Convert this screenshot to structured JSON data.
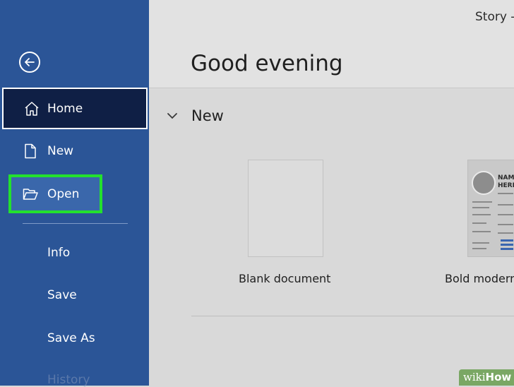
{
  "window": {
    "doc_title": "Story -"
  },
  "sidebar": {
    "items": [
      {
        "label": "Home",
        "icon": "home-icon"
      },
      {
        "label": "New",
        "icon": "new-document-icon"
      },
      {
        "label": "Open",
        "icon": "folder-open-icon"
      }
    ],
    "secondary": [
      {
        "label": "Info"
      },
      {
        "label": "Save"
      },
      {
        "label": "Save As"
      },
      {
        "label": "History"
      }
    ]
  },
  "main": {
    "greeting": "Good evening",
    "new_section": {
      "label": "New"
    },
    "templates": [
      {
        "caption": "Blank document"
      },
      {
        "caption": "Bold modern",
        "preview_text": "NAME HERE"
      }
    ]
  },
  "colors": {
    "sidebar": "#2b5597",
    "selected": "#0f1f45",
    "highlight": "#23e12d",
    "background": "#d9d9d9"
  },
  "watermark": {
    "prefix": "wiki",
    "suffix": "How"
  }
}
